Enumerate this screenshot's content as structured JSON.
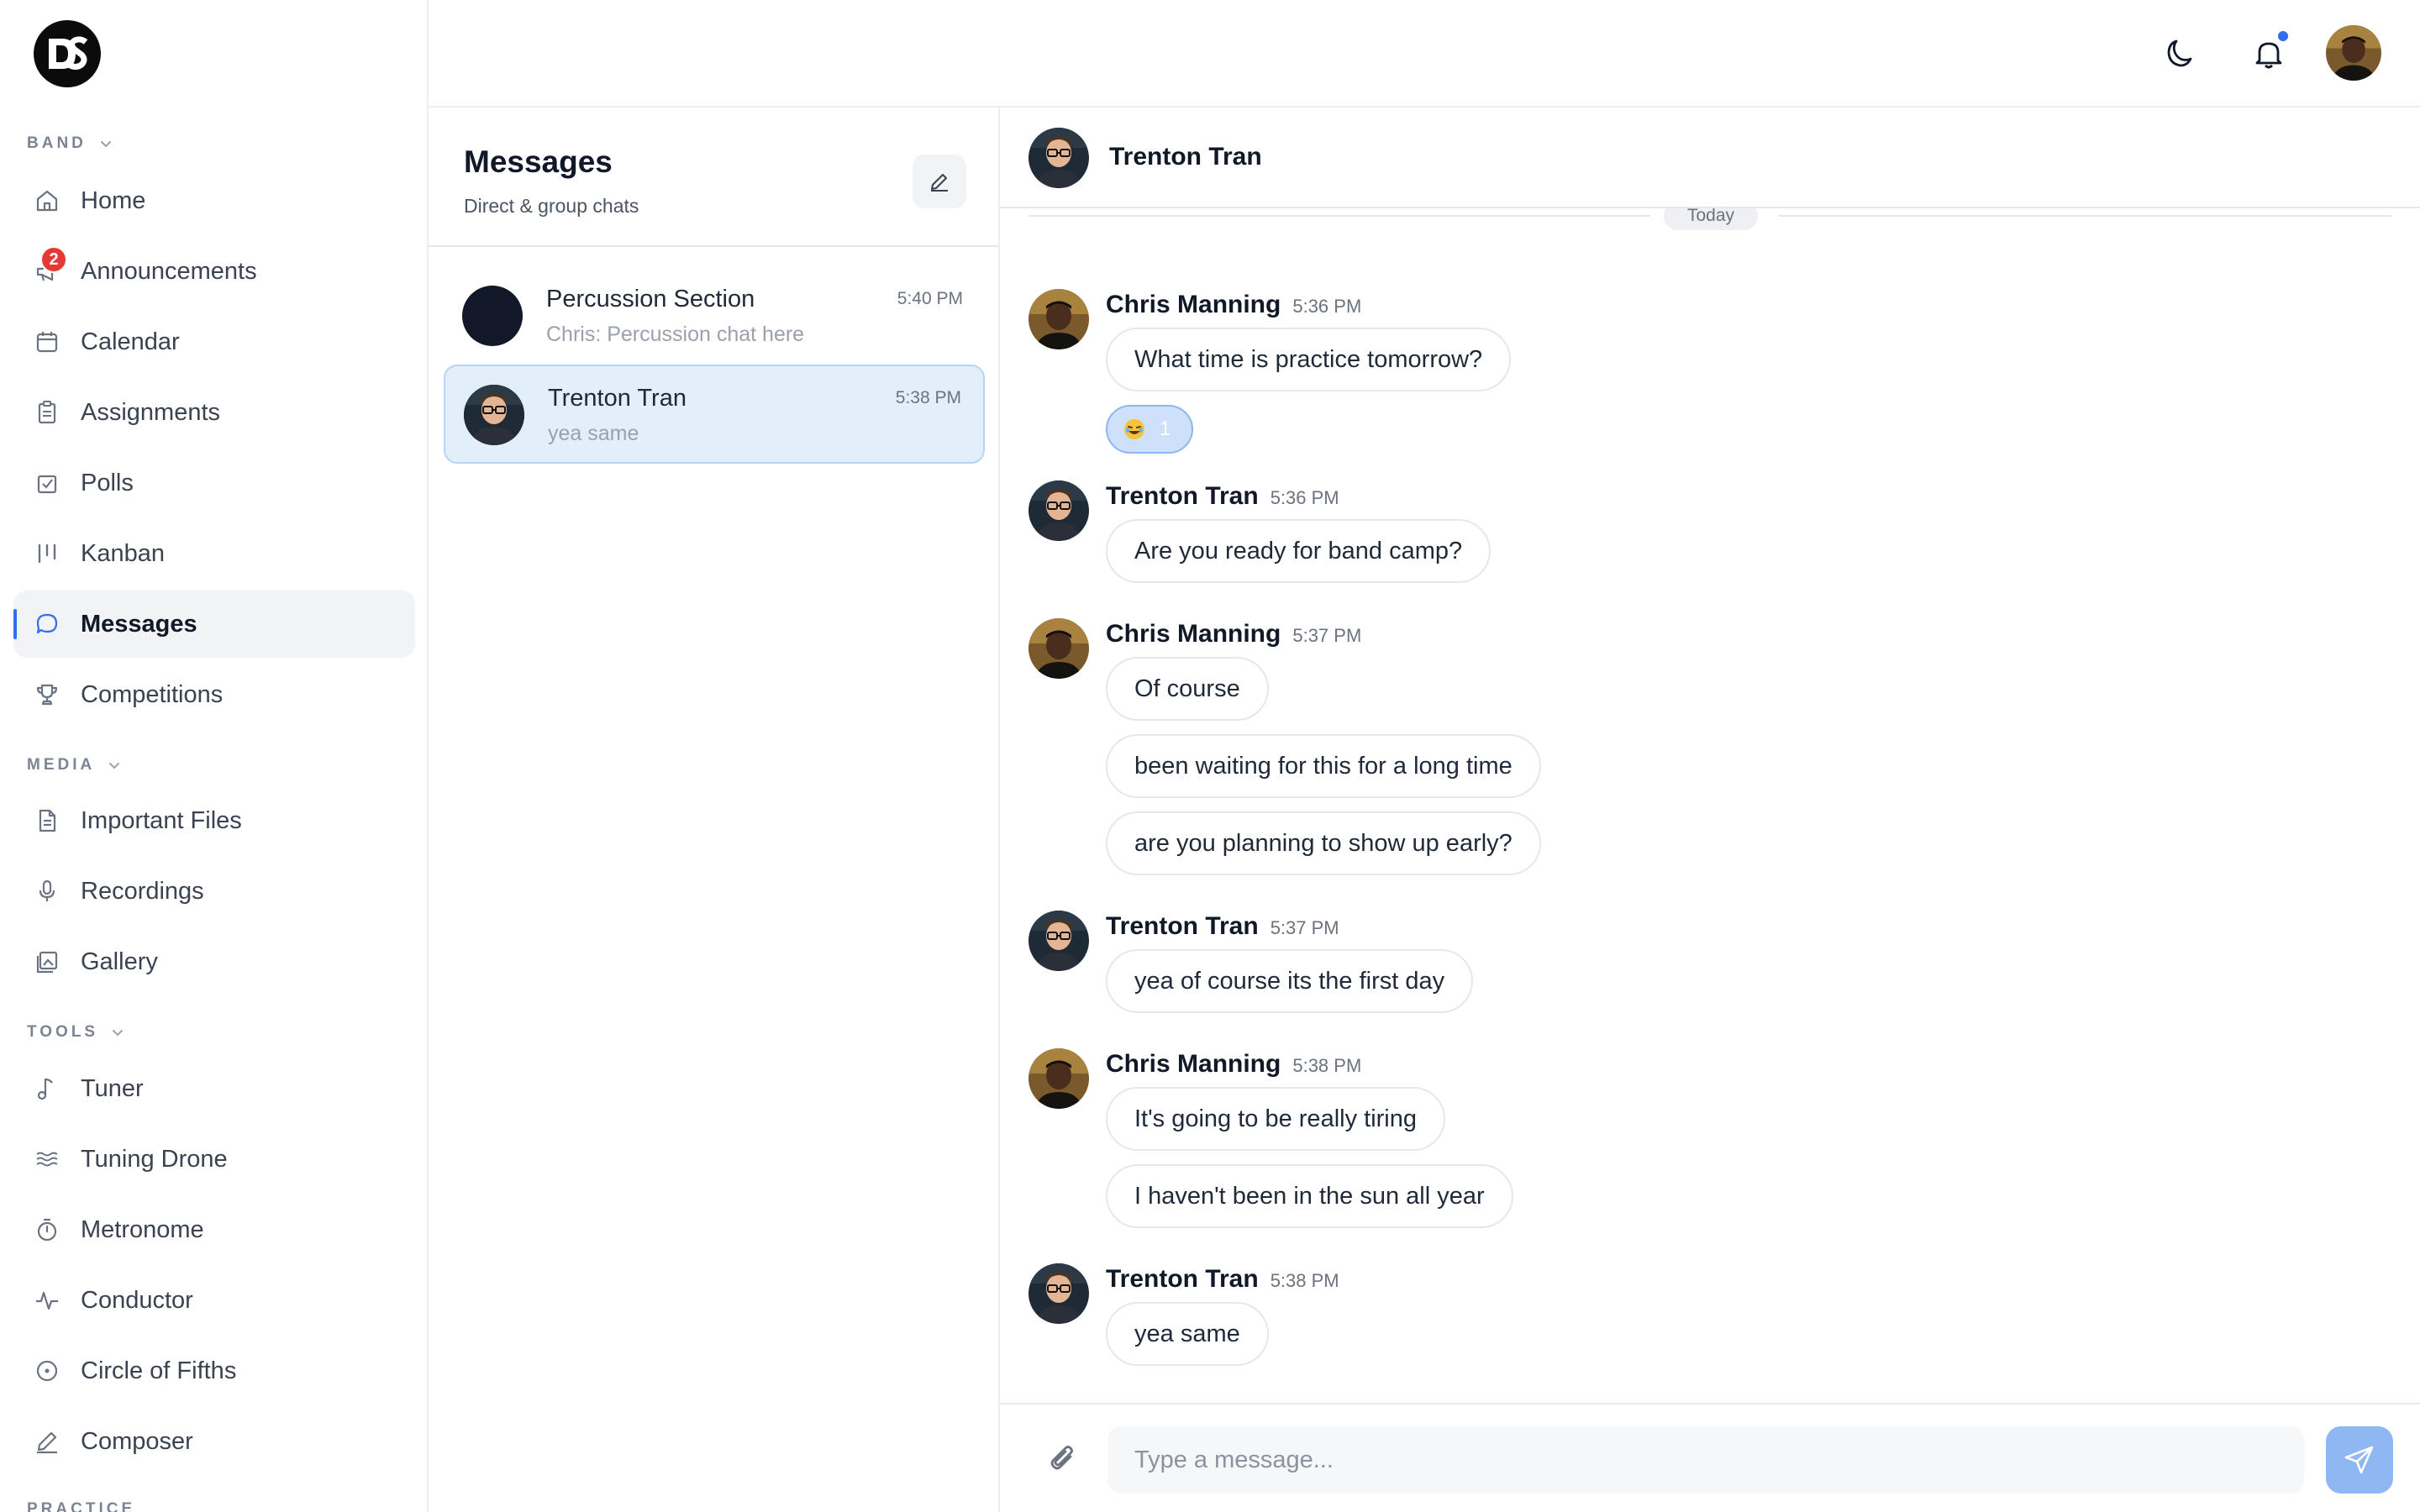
{
  "sidebar": {
    "logo_letters": "DS",
    "sections": {
      "band": "BAND",
      "media": "MEDIA",
      "tools": "TOOLS",
      "practice": "PRACTICE"
    },
    "items": {
      "home": "Home",
      "announcements": "Announcements",
      "announcements_badge": "2",
      "calendar": "Calendar",
      "assignments": "Assignments",
      "polls": "Polls",
      "kanban": "Kanban",
      "messages": "Messages",
      "competitions": "Competitions",
      "important_files": "Important Files",
      "recordings": "Recordings",
      "gallery": "Gallery",
      "tuner": "Tuner",
      "tuning_drone": "Tuning Drone",
      "metronome": "Metronome",
      "conductor": "Conductor",
      "circle_of_fifths": "Circle of Fifths",
      "composer": "Composer"
    },
    "active_item": "messages"
  },
  "topbar": {
    "icons": [
      "moon-icon",
      "bell-icon"
    ],
    "has_unread_notifications": true
  },
  "conversations": {
    "title": "Messages",
    "subtitle": "Direct & group chats",
    "items": [
      {
        "name": "Percussion Section",
        "preview": "Chris: Percussion chat here",
        "time": "5:40 PM",
        "selected": false
      },
      {
        "name": "Trenton Tran",
        "preview": "yea same",
        "time": "5:38 PM",
        "selected": true
      }
    ]
  },
  "chat": {
    "contact_name": "Trenton Tran",
    "date_divider": "Today",
    "groups": [
      {
        "author": "Chris Manning",
        "time": "5:36 PM",
        "messages": [
          "What time is practice tomorrow?"
        ],
        "reaction": {
          "emoji": "laughing-emoji",
          "count": "1"
        }
      },
      {
        "author": "Trenton Tran",
        "time": "5:36 PM",
        "messages": [
          "Are you ready for band camp?"
        ]
      },
      {
        "author": "Chris Manning",
        "time": "5:37 PM",
        "messages": [
          "Of course",
          "been waiting for this for a long time",
          "are you planning to show up early?"
        ]
      },
      {
        "author": "Trenton Tran",
        "time": "5:37 PM",
        "messages": [
          "yea of course its the first day"
        ]
      },
      {
        "author": "Chris Manning",
        "time": "5:38 PM",
        "messages": [
          "It's going to be really tiring",
          "I haven't been in the sun all year"
        ]
      },
      {
        "author": "Trenton Tran",
        "time": "5:38 PM",
        "messages": [
          "yea same"
        ]
      }
    ],
    "composer": {
      "placeholder": "Type a message...",
      "value": ""
    }
  },
  "colors": {
    "accent": "#2f6fed",
    "selected_conversation_bg": "#e3eefb",
    "badge": "#e53935",
    "send_button": "#8fb8f2"
  }
}
